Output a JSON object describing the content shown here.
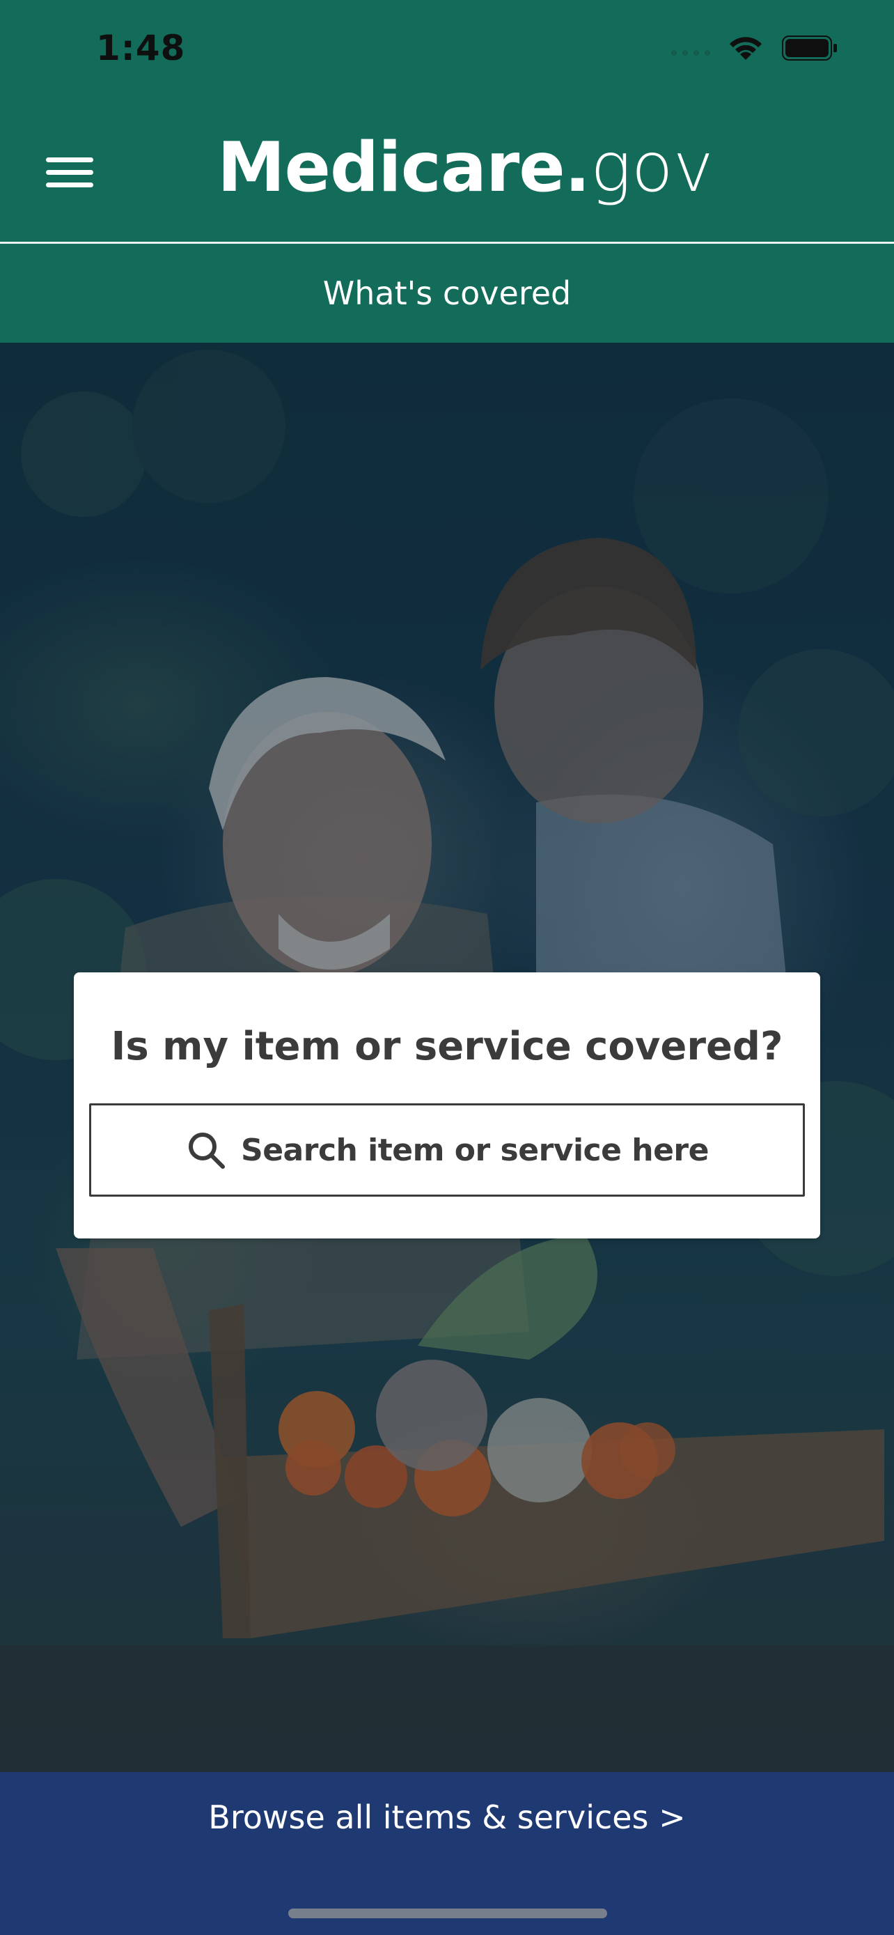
{
  "status_bar": {
    "time": "1:48"
  },
  "header": {
    "logo_brand": "Medicare",
    "logo_dot": ".",
    "logo_tld": "gov",
    "section_title": "What's covered"
  },
  "search_card": {
    "question": "Is my item or service covered?",
    "placeholder": "Search item or service here"
  },
  "footer": {
    "browse_link": "Browse all items & services >"
  },
  "colors": {
    "header_green": "#136b59",
    "footer_blue": "#1f3a72",
    "text_dark": "#3b3b3b"
  },
  "icons": [
    "menu-icon",
    "search-icon",
    "wifi-icon",
    "battery-icon",
    "signal-icon"
  ]
}
